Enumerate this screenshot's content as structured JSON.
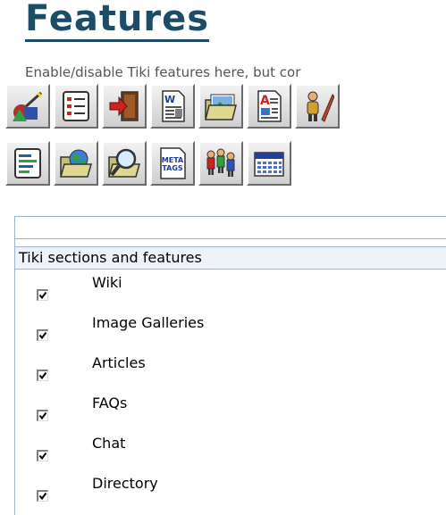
{
  "header": {
    "title": "Features",
    "subtitle": "Enable/disable Tiki features here, but cor"
  },
  "toolbar": {
    "row1": [
      {
        "icon": "wizard-shapes-icon"
      },
      {
        "icon": "checklist-icon"
      },
      {
        "icon": "login-door-icon"
      },
      {
        "icon": "wiki-page-icon"
      },
      {
        "icon": "image-gallery-folder-icon"
      },
      {
        "icon": "articles-icon"
      },
      {
        "icon": "user-pencil-icon"
      }
    ],
    "row2": [
      {
        "icon": "text-lines-icon"
      },
      {
        "icon": "globe-folder-icon"
      },
      {
        "icon": "search-folder-icon"
      },
      {
        "icon": "meta-tags-icon",
        "label_line1": "META",
        "label_line2": "TAGS"
      },
      {
        "icon": "community-icon"
      },
      {
        "icon": "calendar-icon"
      }
    ]
  },
  "section": {
    "title": "Tiki sections and features",
    "features": [
      {
        "label": "Wiki",
        "checked": true
      },
      {
        "label": "Image Galleries",
        "checked": true
      },
      {
        "label": "Articles",
        "checked": true
      },
      {
        "label": "FAQs",
        "checked": true
      },
      {
        "label": "Chat",
        "checked": true
      },
      {
        "label": "Directory",
        "checked": true
      }
    ]
  },
  "colors": {
    "title": "#1d4d66",
    "subtitle": "#555555",
    "section_header_bg": "#eef2f9",
    "border": "#9fb3c8"
  }
}
